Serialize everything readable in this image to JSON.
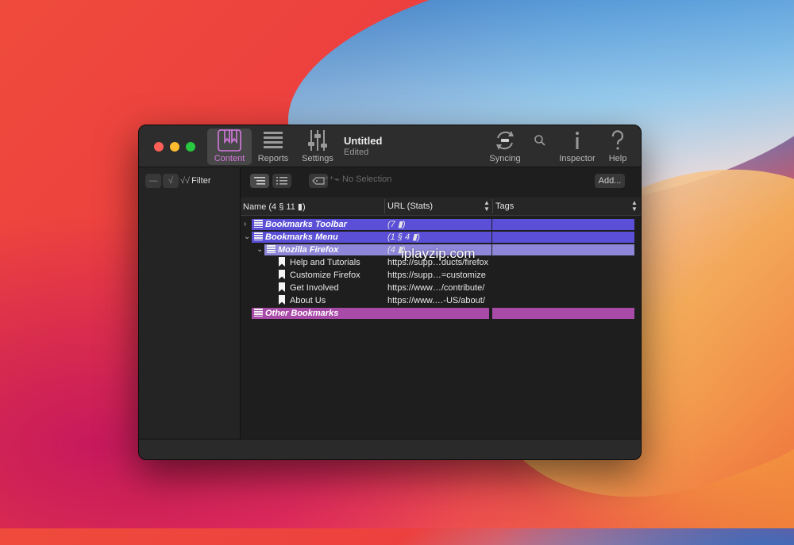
{
  "window": {
    "doc_title": "Untitled",
    "doc_subtitle": "Edited"
  },
  "toolbar": {
    "content_label": "Content",
    "reports_label": "Reports",
    "settings_label": "Settings",
    "syncing_label": "Syncing",
    "inspector_label": "Inspector",
    "help_label": "Help"
  },
  "sidebar": {
    "minus_label": "—",
    "check_label": "√",
    "filter_check": "√√",
    "filter_label": "Filter"
  },
  "main_toolbar": {
    "no_selection": "No Selection",
    "add_label": "Add..."
  },
  "columns": {
    "name": "Name  (4 §   11 ▮)",
    "url": "URL (Stats)",
    "tags": "Tags"
  },
  "rows": [
    {
      "name": "Bookmarks Toolbar",
      "url": "(7 ▮)",
      "tags": "",
      "type": "folder"
    },
    {
      "name": "Bookmarks Menu",
      "url": "(1 §   4 ▮)",
      "tags": "",
      "type": "folder"
    },
    {
      "name": "Mozilla Firefox",
      "url": "(4 ▮)",
      "tags": "",
      "type": "folder"
    },
    {
      "name": "Help and Tutorials",
      "url": "https://supp…ducts/firefox",
      "tags": "",
      "type": "bookmark"
    },
    {
      "name": "Customize Firefox",
      "url": "https://supp…=customize",
      "tags": "",
      "type": "bookmark"
    },
    {
      "name": "Get Involved",
      "url": "https://www…/contribute/",
      "tags": "",
      "type": "bookmark"
    },
    {
      "name": "About Us",
      "url": "https://www.…-US/about/",
      "tags": "",
      "type": "bookmark"
    },
    {
      "name": "Other Bookmarks",
      "url": "",
      "tags": "",
      "type": "folder"
    }
  ],
  "colors": {
    "toolbar_folder": "#5a4fd6",
    "menu_folder": "#5a4fd6",
    "firefox_folder": "#8e86d8",
    "other_folder": "#a84aa8",
    "accent": "#d67ae0"
  },
  "watermark": "iplayzip.com"
}
